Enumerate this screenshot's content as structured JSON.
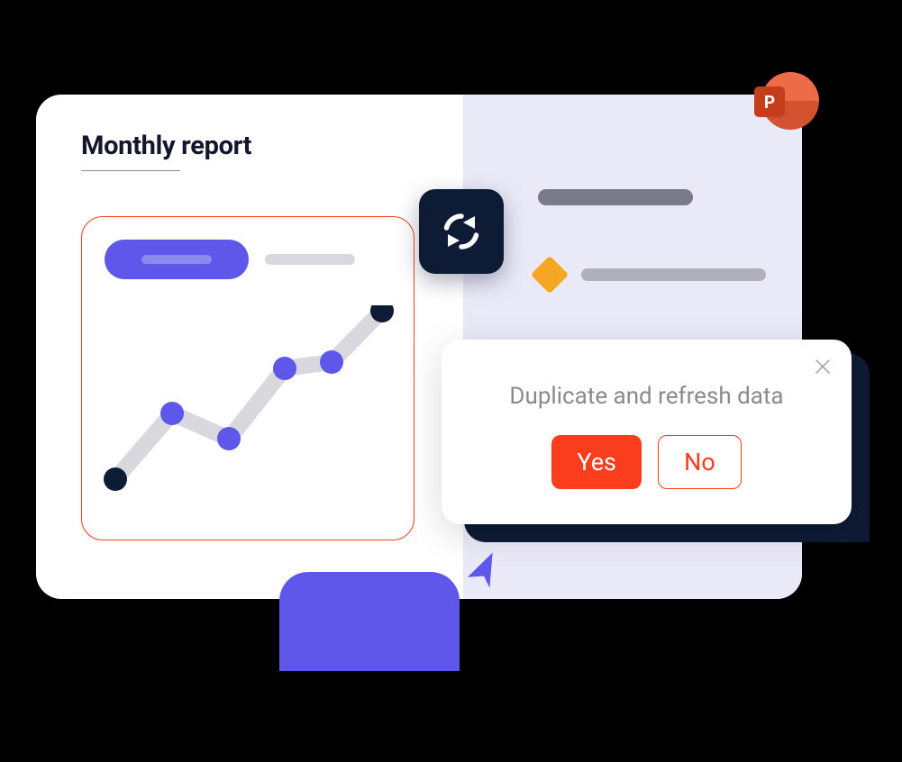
{
  "report": {
    "title": "Monthly report"
  },
  "dialog": {
    "title": "Duplicate and refresh data",
    "yes_label": "Yes",
    "no_label": "No"
  },
  "powerpoint": {
    "letter": "P"
  },
  "colors": {
    "accent_purple": "#5E57E9",
    "accent_orange": "#FA3D1C",
    "dark_navy": "#0E1B34",
    "pp_orange": "#D35230"
  },
  "chart_data": {
    "type": "line",
    "x": [
      0,
      1,
      2,
      3,
      4,
      5
    ],
    "values": [
      18,
      50,
      38,
      72,
      75,
      100
    ],
    "title": "",
    "xlabel": "",
    "ylabel": "",
    "ylim": [
      0,
      100
    ]
  }
}
